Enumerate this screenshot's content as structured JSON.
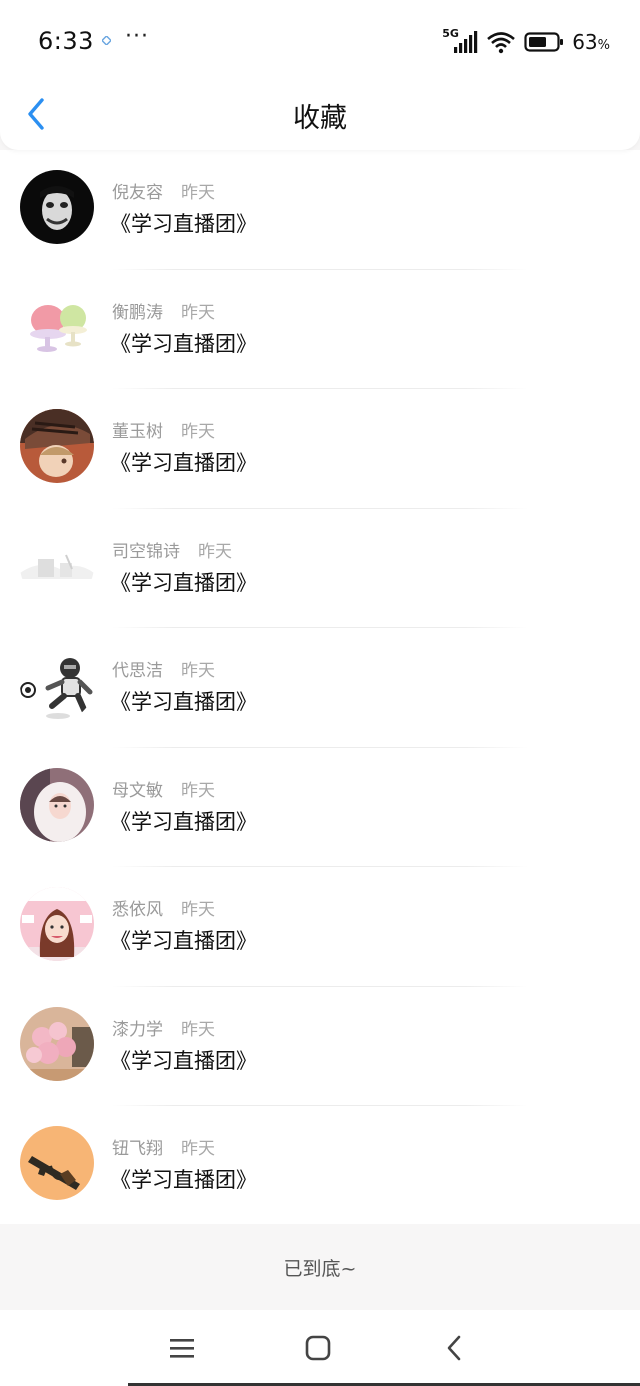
{
  "status": {
    "time": "6:33",
    "network": "5G",
    "battery": "63",
    "battery_unit": "%",
    "more": "···"
  },
  "header": {
    "title": "收藏",
    "accent_color": "#2b8ff1"
  },
  "items": [
    {
      "name": "倪友容",
      "time": "昨天",
      "title": "《学习直播团》",
      "avatar": "joker-face"
    },
    {
      "name": "衡鹏涛",
      "time": "昨天",
      "title": "《学习直播团》",
      "avatar": "shaved-ice-dessert"
    },
    {
      "name": "董玉树",
      "time": "昨天",
      "title": "《学习直播团》",
      "avatar": "anime-character-hat"
    },
    {
      "name": "司空锦诗",
      "time": "昨天",
      "title": "《学习直播团》",
      "avatar": "faded-landscape"
    },
    {
      "name": "代思洁",
      "time": "昨天",
      "title": "《学习直播团》",
      "avatar": "robot-soccer"
    },
    {
      "name": "母文敏",
      "time": "昨天",
      "title": "《学习直播团》",
      "avatar": "girl-white-hood"
    },
    {
      "name": "悉依风",
      "time": "昨天",
      "title": "《学习直播团》",
      "avatar": "girl-pink-stage"
    },
    {
      "name": "漆力学",
      "time": "昨天",
      "title": "《学习直播团》",
      "avatar": "pink-balloons"
    },
    {
      "name": "钮飞翔",
      "time": "昨天",
      "title": "《学习直播团》",
      "avatar": "rifle-orange"
    }
  ],
  "footer": {
    "end_text": "已到底~"
  }
}
